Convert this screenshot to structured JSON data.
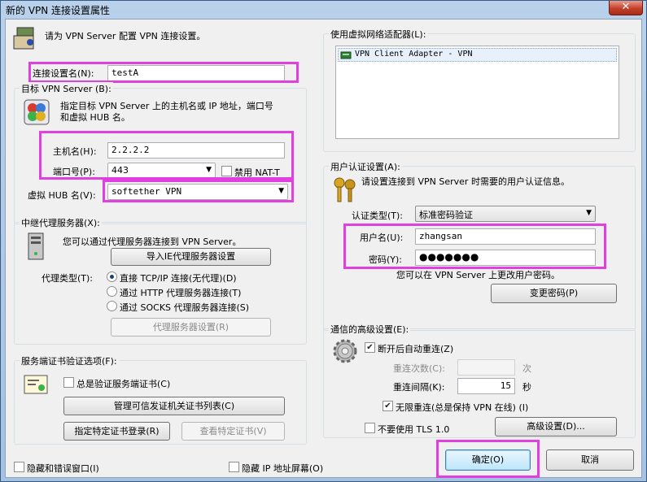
{
  "window": {
    "title": "新的 VPN 连接设置属性",
    "close_label": "✕"
  },
  "header": {
    "instruction": "请为 VPN Server 配置 VPN 连接设置。"
  },
  "connection": {
    "name_label": "连接设置名(N):",
    "name_value": "testA"
  },
  "target": {
    "group_title": "目标 VPN Server (B):",
    "description_line1": "指定目标 VPN Server 上的主机名或 IP 地址，端口号",
    "description_line2": "和虚拟 HUB 名。",
    "host_label": "主机名(H):",
    "host_value": "2.2.2.2",
    "port_label": "端口号(P):",
    "port_value": "443",
    "disable_nat_label": "禁用 NAT-T",
    "hub_label": "虚拟 HUB 名(V):",
    "hub_value": "softether VPN"
  },
  "proxy": {
    "group_title": "中继代理服务器(X):",
    "description": "您可以通过代理服务器连接到 VPN Server。",
    "import_ie_button": "导入IE代理服务器设置",
    "type_label": "代理类型(T):",
    "options": [
      "直接 TCP/IP 连接(无代理)(D)",
      "通过 HTTP 代理服务器连接(T)",
      "通过 SOCKS 代理服务器连接(S)"
    ],
    "selected_index": 0,
    "settings_button": "代理服务器设置(R)"
  },
  "cert": {
    "group_title": "服务端证书验证选项(F):",
    "always_verify_label": "总是验证服务端证书(C)",
    "manage_ca_button": "管理可信发证机关证书列表(C)",
    "specify_cert_button": "指定特定证书登录(R)",
    "view_cert_button": "查看特定证书(V)"
  },
  "bottom": {
    "hide_status_label": "隐藏和错误窗口(I)",
    "hide_ip_label": "隐藏 IP 地址屏幕(O)"
  },
  "adapter": {
    "group_title": "使用虚拟网络适配器(L):",
    "items": [
      "VPN Client Adapter - VPN"
    ]
  },
  "auth": {
    "group_title": "用户认证设置(A):",
    "description": "请设置连接到 VPN Server 时需要的用户认证信息。",
    "type_label": "认证类型(T):",
    "type_value": "标准密码验证",
    "username_label": "用户名(U):",
    "username_value": "zhangsan",
    "password_label": "密码(Y):",
    "password_mask": "●●●●●●●",
    "change_note": "您可以在 VPN Server 上更改用户密码。",
    "change_password_button": "变更密码(P)"
  },
  "advanced": {
    "group_title": "通信的高级设置(E):",
    "auto_reconnect_label": "断开后自动重连(Z)",
    "retry_count_label": "重连次数(C):",
    "retry_count_unit": "次",
    "retry_interval_label": "重连间隔(K):",
    "retry_interval_value": "15",
    "retry_interval_unit": "秒",
    "infinite_retry_label": "无限重连(总是保持 VPN 在线) (I)",
    "no_tls_label": "不要使用 TLS 1.0",
    "advanced_button": "高级设置(D)..."
  },
  "footer": {
    "ok_button": "确定(O)",
    "cancel_button": "取消"
  },
  "colors": {
    "highlight": "#e040e0",
    "title_bar": "#b9d1ea",
    "close_button": "#c4402b"
  }
}
